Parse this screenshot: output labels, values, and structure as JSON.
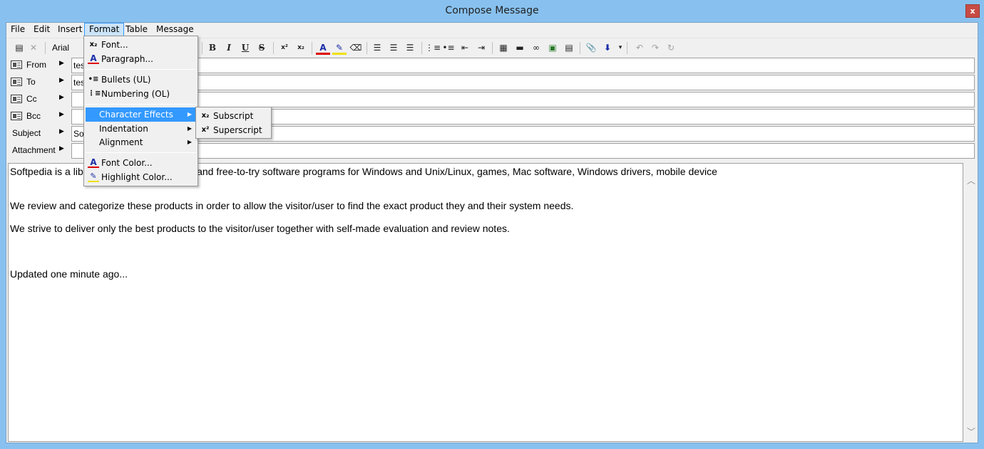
{
  "window": {
    "title": "Compose Message",
    "close_label": "x"
  },
  "menubar": [
    "File",
    "Edit",
    "Insert",
    "Format",
    "Table",
    "Message"
  ],
  "toolbar": {
    "font_name": "Arial",
    "bold": "B",
    "italic": "I",
    "underline": "U",
    "strike": "S",
    "superscript": "x²",
    "subscript": "x₂"
  },
  "fields": [
    {
      "label": "From",
      "value": "tes"
    },
    {
      "label": "To",
      "value": "tes"
    },
    {
      "label": "Cc",
      "value": ""
    },
    {
      "label": "Bcc",
      "value": ""
    },
    {
      "label": "Subject",
      "value": "Sof"
    },
    {
      "label": "Attachment",
      "value": ""
    }
  ],
  "body": {
    "line1": "Softpedia is a libr",
    "line1_tail": "e and free-to-try software programs for Windows and Unix/Linux, games, Mac software, Windows drivers, mobile device",
    "line2": "We review and categorize these products in order to allow the visitor/user to find the exact product they and their system needs.",
    "line3": "We strive to deliver only the best products to the visitor/user together with self-made evaluation and review notes.",
    "line4": "Updated one minute ago..."
  },
  "format_menu": {
    "font": "Font...",
    "paragraph": "Paragraph...",
    "bullets": "Bullets (UL)",
    "numbering": "Numbering (OL)",
    "character_effects": "Character Effects",
    "indentation": "Indentation",
    "alignment": "Alignment",
    "font_color": "Font Color...",
    "highlight_color": "Highlight Color..."
  },
  "char_effects_menu": {
    "subscript": "Subscript",
    "superscript": "Superscript"
  },
  "colors": {
    "menu_highlight": "#3399ff",
    "titlebar": "#88c1ef",
    "close": "#c74b45"
  }
}
